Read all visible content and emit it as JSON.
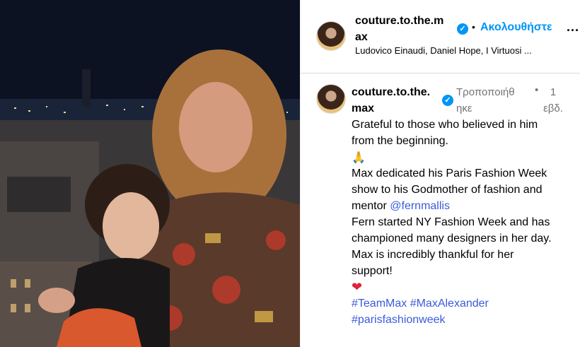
{
  "post": {
    "photo_icon": "post-photo",
    "header": {
      "username": "couture.to.the.max",
      "username_wrap": [
        "couture.to.the.m",
        "ax"
      ],
      "verified_icon": "verified-badge-icon",
      "separator": "•",
      "follow_label": "Ακολουθήστε",
      "more_label": "...",
      "music": "Ludovico Einaudi, Daniel Hope, I Virtuosi ..."
    },
    "caption": {
      "username_wrap": [
        "couture.to.the.",
        "max"
      ],
      "edited_wrap": [
        "Τροποποιήθ",
        "ηκε"
      ],
      "separator": "•",
      "time_wrap": [
        "1",
        "εβδ."
      ],
      "lines": [
        "Grateful to those who believed in him",
        "from the beginning.",
        "🙏",
        "Max dedicated his Paris Fashion Week",
        "show to his Godmother of fashion and",
        "mentor ",
        "Fern started NY Fashion Week and has",
        "championed many designers in her day.",
        "Max is incredibly thankful for her",
        "support!",
        "❤"
      ],
      "mention": "@fernmallis",
      "hashtags_line1": [
        "#TeamMax",
        "#MaxAlexander"
      ],
      "hashtags_line2": "#parisfashionweek"
    }
  },
  "colors": {
    "accent": "#0095f6",
    "link": "#3b5bdb",
    "muted": "#737373",
    "heart": "#e0243a"
  }
}
